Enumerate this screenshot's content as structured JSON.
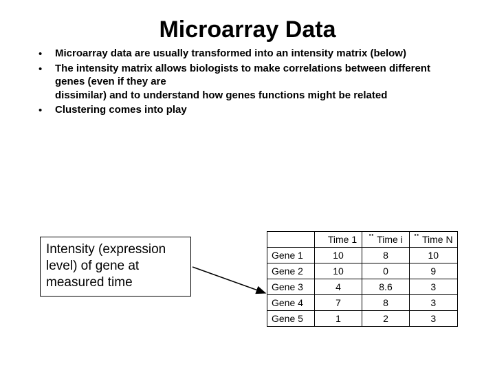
{
  "title": "Microarray Data",
  "bullets": [
    {
      "marker": "•",
      "text": "Microarray data are usually transformed into an intensity matrix (below)"
    },
    {
      "marker": "•",
      "text": "The intensity matrix allows biologists to make correlations between different genes (even if they are"
    },
    {
      "marker": "",
      "text": "dissimilar) and to understand how genes functions might be related"
    },
    {
      "marker": "•",
      "text": "Clustering comes into play"
    }
  ],
  "caption": "Intensity (expression level) of gene at measured time",
  "table": {
    "columns": [
      "Time 1",
      "Time i",
      "Time N"
    ],
    "column_dots": [
      "",
      "··",
      "··"
    ],
    "rows": [
      {
        "label": "Gene 1",
        "values": [
          "10",
          "8",
          "10"
        ]
      },
      {
        "label": "Gene 2",
        "values": [
          "10",
          "0",
          "9"
        ]
      },
      {
        "label": "Gene 3",
        "values": [
          "4",
          "8.6",
          "3"
        ]
      },
      {
        "label": "Gene 4",
        "values": [
          "7",
          "8",
          "3"
        ]
      },
      {
        "label": "Gene 5",
        "values": [
          "1",
          "2",
          "3"
        ]
      }
    ]
  }
}
